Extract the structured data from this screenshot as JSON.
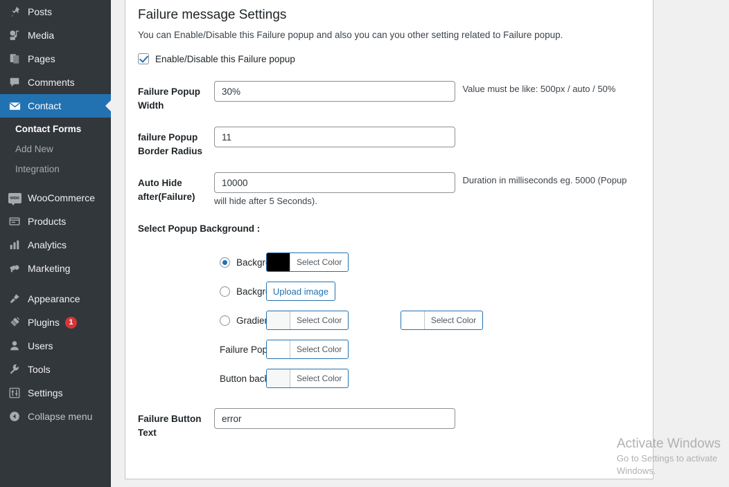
{
  "sidebar": {
    "items": [
      {
        "label": "Posts",
        "icon": "pin-icon",
        "active": false
      },
      {
        "label": "Media",
        "icon": "media-icon",
        "active": false
      },
      {
        "label": "Pages",
        "icon": "pages-icon",
        "active": false
      },
      {
        "label": "Comments",
        "icon": "comments-icon",
        "active": false
      },
      {
        "label": "Contact",
        "icon": "envelope-icon",
        "active": true
      }
    ],
    "submenu": [
      {
        "label": "Contact Forms",
        "current": true
      },
      {
        "label": "Add New",
        "current": false
      },
      {
        "label": "Integration",
        "current": false
      }
    ],
    "items2": [
      {
        "label": "WooCommerce",
        "icon": "woocommerce-icon"
      },
      {
        "label": "Products",
        "icon": "products-icon"
      },
      {
        "label": "Analytics",
        "icon": "analytics-icon"
      },
      {
        "label": "Marketing",
        "icon": "marketing-icon"
      }
    ],
    "items3": [
      {
        "label": "Appearance",
        "icon": "appearance-icon"
      },
      {
        "label": "Plugins",
        "icon": "plugins-icon",
        "badge": "1"
      },
      {
        "label": "Users",
        "icon": "users-icon"
      },
      {
        "label": "Tools",
        "icon": "tools-icon"
      },
      {
        "label": "Settings",
        "icon": "settings-icon"
      }
    ],
    "collapse": {
      "label": "Collapse menu",
      "icon": "collapse-icon"
    },
    "colors": {
      "background": "#32373c",
      "active": "#2271b1",
      "badge": "#d63638"
    }
  },
  "page": {
    "title": "Failure message Settings",
    "description": "You can Enable/Disable this Failure popup and also you can you other setting related to Failure popup.",
    "enable_label": "Enable/Disable this Failure popup",
    "enable_checked": true
  },
  "fields": {
    "width": {
      "label": "Failure Popup Width",
      "value": "30%",
      "hint": "Value must be like: 500px / auto / 50%"
    },
    "border_radius": {
      "label": "failure Popup Border Radius",
      "value": "11",
      "hint": ""
    },
    "auto_hide": {
      "label": "Auto Hide after(Failure)",
      "value": "10000",
      "hint": "Duration in milliseconds eg. 5000 (Popup will hide after 5 Seconds)."
    },
    "button_text": {
      "label": "Failure Button Text",
      "value": "error",
      "hint": ""
    }
  },
  "background_section": {
    "title": "Select Popup Background :",
    "options": [
      {
        "label": "Background Color",
        "selected": true,
        "type": "radio"
      },
      {
        "label": "Background Image",
        "selected": false,
        "type": "radio"
      },
      {
        "label": "Gradient Color",
        "selected": false,
        "type": "radio"
      },
      {
        "label": "Failure Popup Text Color",
        "selected": false,
        "type": "text"
      },
      {
        "label": "Button background color",
        "selected": false,
        "type": "text"
      }
    ],
    "select_color_label": "Select Color",
    "upload_image_label": "Upload image",
    "swatches": {
      "background_color": "#000000",
      "gradient_start": "#f6f7f7",
      "gradient_end": "#ffffff",
      "text_color": "#ffffff",
      "button_color": "#f6f7f7"
    }
  },
  "watermark": {
    "line1": "Activate Windows",
    "line2": "Go to Settings to activate Windows."
  }
}
